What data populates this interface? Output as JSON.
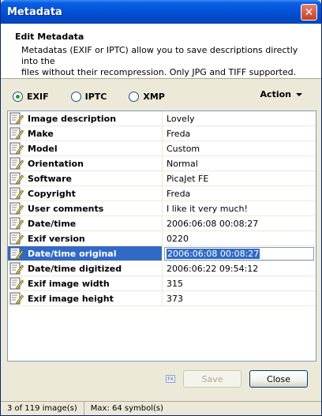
{
  "window": {
    "title": "Metadata",
    "close_glyph": "✕"
  },
  "header": {
    "title": "Edit Metadata",
    "desc_line1": "Metadatas (EXIF or IPTC) allow you to save descriptions directly into the",
    "desc_line2": "files without their recompression. Only JPG and TIFF supported."
  },
  "tabs": {
    "exif": "EXIF",
    "iptc": "IPTC",
    "xmp": "XMP",
    "selected": "EXIF",
    "action_label": "Action"
  },
  "rows": [
    {
      "name": "Image description",
      "value": "Lovely"
    },
    {
      "name": "Make",
      "value": "Freda"
    },
    {
      "name": "Model",
      "value": "Custom"
    },
    {
      "name": "Orientation",
      "value": "Normal"
    },
    {
      "name": "Software",
      "value": "PicaJet FE"
    },
    {
      "name": "Copyright",
      "value": "Freda"
    },
    {
      "name": "User comments",
      "value": "I like it very much!"
    },
    {
      "name": "Date/time",
      "value": "2006:06:08 00:08:27"
    },
    {
      "name": "Exif version",
      "value": "0220"
    },
    {
      "name": "Date/time original",
      "value": "2006:06:08 00:08:27"
    },
    {
      "name": "Date/time digitized",
      "value": "2006:06:22 09:54:12"
    },
    {
      "name": "Exif image width",
      "value": "315"
    },
    {
      "name": "Exif image height",
      "value": "373"
    }
  ],
  "selected_row": 9,
  "buttons": {
    "save": "Save",
    "close": "Close",
    "fx": "FX"
  },
  "status": {
    "count": "3 of 119 image(s)",
    "max": "Max: 64 symbol(s)"
  }
}
